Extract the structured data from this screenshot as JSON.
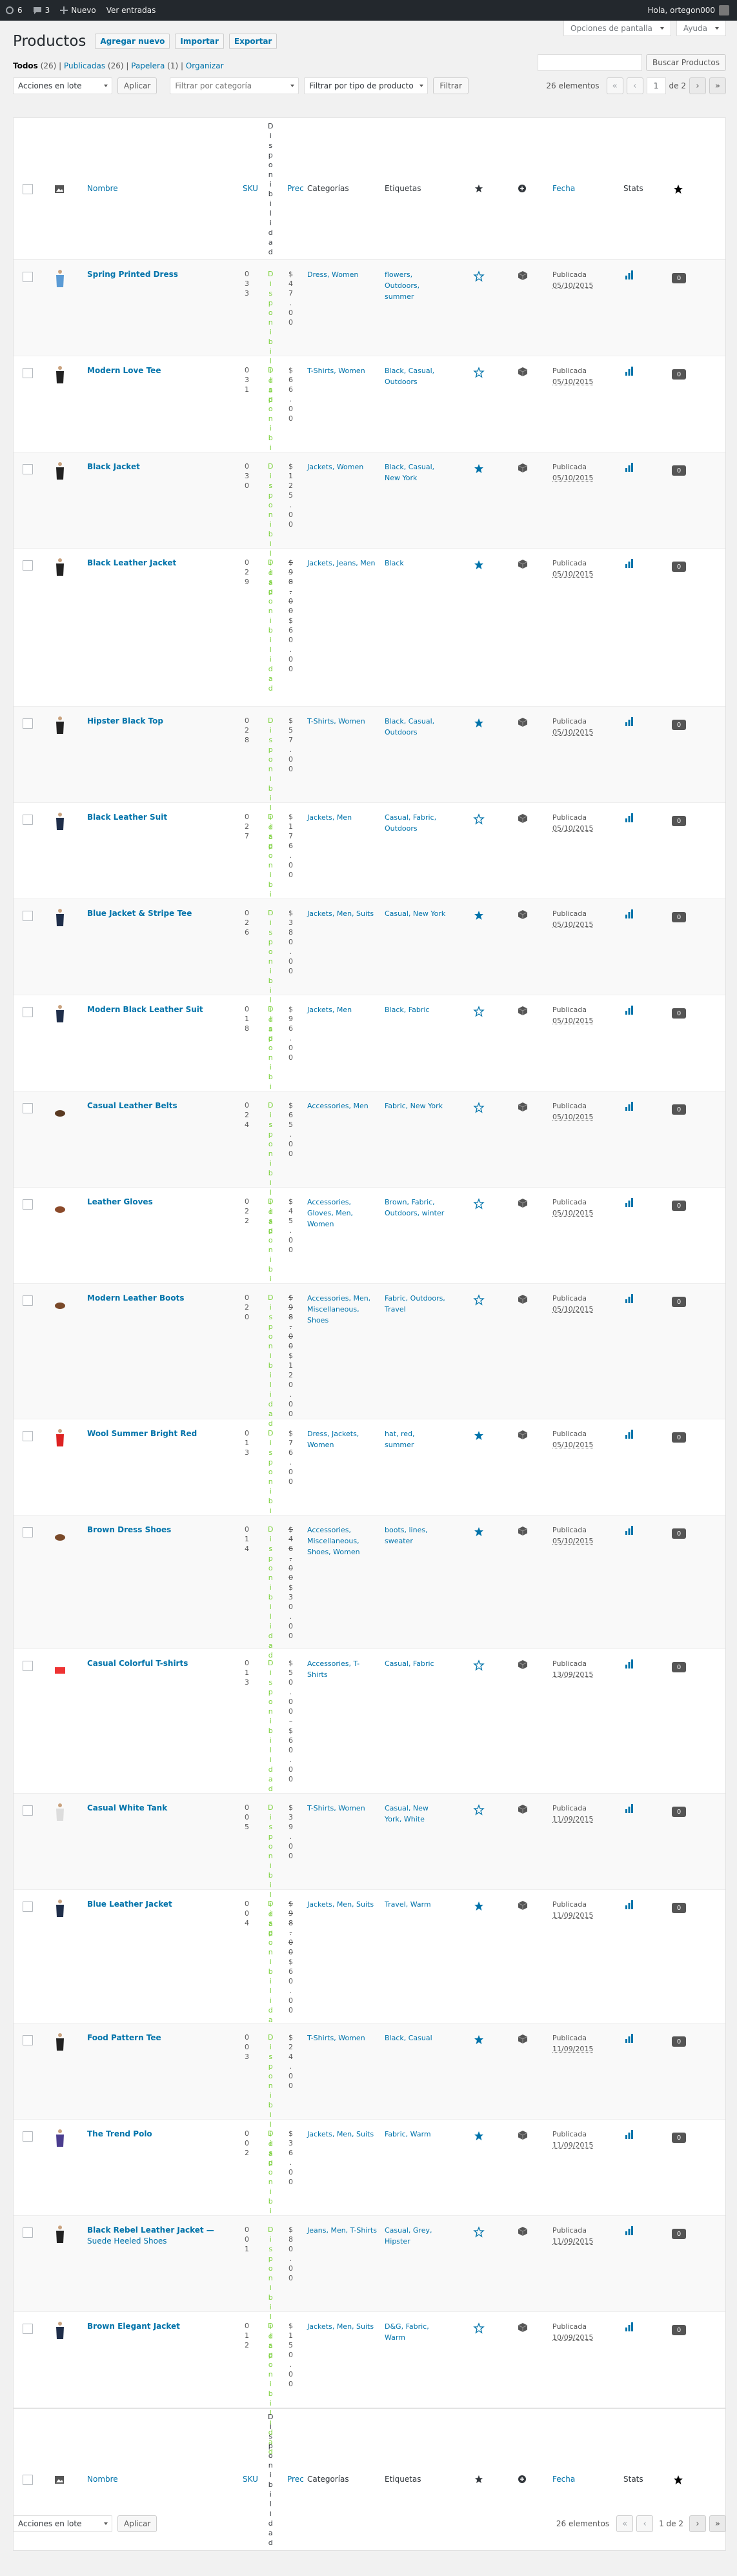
{
  "adminbar": {
    "updates": "6",
    "comments": "3",
    "new_label": "Nuevo",
    "view_entries": "Ver entradas",
    "greeting": "Hola, ortegon000"
  },
  "screen_options": "Opciones de pantalla",
  "help": "Ayuda",
  "page": {
    "title": "Productos",
    "add_new": "Agregar nuevo",
    "import": "Importar",
    "export": "Exportar"
  },
  "views": {
    "all": "Todos",
    "all_count": "(26)",
    "published": "Publicadas",
    "published_count": "(26)",
    "trash": "Papelera",
    "trash_count": "(1)",
    "sort": "Organizar",
    "sep": "|"
  },
  "search": {
    "placeholder": "",
    "button": "Buscar Productos"
  },
  "filters": {
    "bulk": "Acciones en lote",
    "apply": "Aplicar",
    "category": "Filtrar por categoría",
    "type": "Filtrar por tipo de producto",
    "filter": "Filtrar"
  },
  "pagination": {
    "items": "26 elementos",
    "first": "«",
    "prev": "‹",
    "current": "1",
    "of": "de 2",
    "next": "›",
    "last": "»",
    "bottom_page": "1 de 2"
  },
  "columns": {
    "name": "Nombre",
    "sku": "SKU",
    "stock": "Disponibilidad",
    "price": "Precio",
    "categories": "Categorías",
    "tags": "Etiquetas",
    "date": "Fecha",
    "stats": "Stats"
  },
  "colors": {
    "link": "#0073aa",
    "instock": "#7ad03a",
    "featured": "#0073aa",
    "badge": "#555555"
  },
  "products": [
    {
      "name": "Spring Printed Dress",
      "sub": "",
      "sku": "033",
      "price": "$47.00",
      "categories": "Dress, Women",
      "tags": "flowers, Outdoors, summer",
      "featured": false,
      "status": "Publicada",
      "date": "05/10/2015",
      "count": "0",
      "thumb": "dress"
    },
    {
      "name": "Modern Love Tee",
      "sub": "",
      "sku": "031",
      "price": "$66.00",
      "categories": "T-Shirts, Women",
      "tags": "Black, Casual, Outdoors",
      "featured": false,
      "status": "Publicada",
      "date": "05/10/2015",
      "count": "0",
      "thumb": "tee"
    },
    {
      "name": "Black Jacket",
      "sub": "",
      "sku": "030",
      "price": "$125.00",
      "categories": "Jackets, Women",
      "tags": "Black, Casual, New York",
      "featured": true,
      "status": "Publicada",
      "date": "05/10/2015",
      "count": "0",
      "thumb": "jacket"
    },
    {
      "name": "Black Leather Jacket",
      "sub": "",
      "sku": "029",
      "price": "$98.00$60.00",
      "strike": true,
      "categories": "Jackets, Jeans, Men",
      "tags": "Black",
      "featured": true,
      "status": "Publicada",
      "date": "05/10/2015",
      "count": "0",
      "thumb": "jacket"
    },
    {
      "name": "Hipster Black Top",
      "sub": "",
      "sku": "028",
      "price": "$57.00",
      "categories": "T-Shirts, Women",
      "tags": "Black, Casual, Outdoors",
      "featured": true,
      "status": "Publicada",
      "date": "05/10/2015",
      "count": "0",
      "thumb": "tee"
    },
    {
      "name": "Black Leather Suit",
      "sub": "",
      "sku": "027",
      "price": "$176.00",
      "categories": "Jackets, Men",
      "tags": "Casual, Fabric, Outdoors",
      "featured": false,
      "status": "Publicada",
      "date": "05/10/2015",
      "count": "0",
      "thumb": "suit"
    },
    {
      "name": "Blue Jacket & Stripe Tee",
      "sub": "",
      "sku": "026",
      "price": "$380.00",
      "categories": "Jackets, Men, Suits",
      "tags": "Casual, New York",
      "featured": true,
      "status": "Publicada",
      "date": "05/10/2015",
      "count": "0",
      "thumb": "suit"
    },
    {
      "name": "Modern Black Leather Suit",
      "sub": "",
      "sku": "018",
      "price": "$96.00",
      "categories": "Jackets, Men",
      "tags": "Black, Fabric",
      "featured": false,
      "status": "Publicada",
      "date": "05/10/2015",
      "count": "0",
      "thumb": "suit"
    },
    {
      "name": "Casual Leather Belts",
      "sub": "",
      "sku": "024",
      "price": "$65.00",
      "categories": "Accessories, Men",
      "tags": "Fabric, New York",
      "featured": false,
      "status": "Publicada",
      "date": "05/10/2015",
      "count": "0",
      "thumb": "belt"
    },
    {
      "name": "Leather Gloves",
      "sub": "",
      "sku": "022",
      "price": "$45.00",
      "categories": "Accessories, Gloves, Men, Women",
      "tags": "Brown, Fabric, Outdoors, winter",
      "featured": false,
      "status": "Publicada",
      "date": "05/10/2015",
      "count": "0",
      "thumb": "glove"
    },
    {
      "name": "Modern Leather Boots",
      "sub": "",
      "sku": "020",
      "price": "$98.00$120.00",
      "strike": true,
      "categories": "Accessories, Men, Miscellaneous, Shoes",
      "tags": "Fabric, Outdoors, Travel",
      "featured": false,
      "status": "Publicada",
      "date": "05/10/2015",
      "count": "0",
      "thumb": "shoe"
    },
    {
      "name": "Wool Summer Bright Red",
      "sub": "",
      "sku": "013",
      "price": "$76.00",
      "categories": "Dress, Jackets, Women",
      "tags": "hat, red, summer",
      "featured": true,
      "status": "Publicada",
      "date": "05/10/2015",
      "count": "0",
      "thumb": "red"
    },
    {
      "name": "Brown Dress Shoes",
      "sub": "",
      "sku": "014",
      "price": "$46.00$30.00",
      "strike": true,
      "categories": "Accessories, Miscellaneous, Shoes, Women",
      "tags": "boots, lines, sweater",
      "featured": true,
      "status": "Publicada",
      "date": "05/10/2015",
      "count": "0",
      "thumb": "shoe"
    },
    {
      "name": "Casual Colorful T-shirts",
      "sub": "",
      "sku": "013",
      "price": "$50.00–$60.00",
      "categories": "Accessories, T-Shirts",
      "tags": "Casual, Fabric",
      "featured": false,
      "status": "Publicada",
      "date": "13/09/2015",
      "count": "0",
      "thumb": "shirts"
    },
    {
      "name": "Casual White Tank",
      "sub": "",
      "sku": "005",
      "price": "$39.00",
      "categories": "T-Shirts, Women",
      "tags": "Casual, New York, White",
      "featured": false,
      "status": "Publicada",
      "date": "11/09/2015",
      "count": "0",
      "thumb": "tank"
    },
    {
      "name": "Blue Leather Jacket",
      "sub": "",
      "sku": "004",
      "price": "$98.00$60.00",
      "strike": true,
      "categories": "Jackets, Men, Suits",
      "tags": "Travel, Warm",
      "featured": true,
      "status": "Publicada",
      "date": "11/09/2015",
      "count": "0",
      "thumb": "suit"
    },
    {
      "name": "Food Pattern Tee",
      "sub": "",
      "sku": "003",
      "price": "$24.00",
      "categories": "T-Shirts, Women",
      "tags": "Black, Casual",
      "featured": true,
      "status": "Publicada",
      "date": "11/09/2015",
      "count": "0",
      "thumb": "tee"
    },
    {
      "name": "The Trend Polo",
      "sub": "",
      "sku": "002",
      "price": "$36.00",
      "categories": "Jackets, Men, Suits",
      "tags": "Fabric, Warm",
      "featured": true,
      "status": "Publicada",
      "date": "11/09/2015",
      "count": "0",
      "thumb": "polo"
    },
    {
      "name": "Black Rebel Leather Jacket —",
      "sub": "Suede Heeled Shoes",
      "sku": "001",
      "price": "$80.00",
      "categories": "Jeans, Men, T-Shirts",
      "tags": "Casual, Grey, Hipster",
      "featured": false,
      "status": "Publicada",
      "date": "11/09/2015",
      "count": "0",
      "thumb": "jacket"
    },
    {
      "name": "Brown Elegant Jacket",
      "sub": "",
      "sku": "012",
      "price": "$150.00",
      "categories": "Jackets, Men, Suits",
      "tags": "D&G, Fabric, Warm",
      "featured": false,
      "status": "Publicada",
      "date": "10/09/2015",
      "count": "0",
      "thumb": "suit"
    }
  ]
}
